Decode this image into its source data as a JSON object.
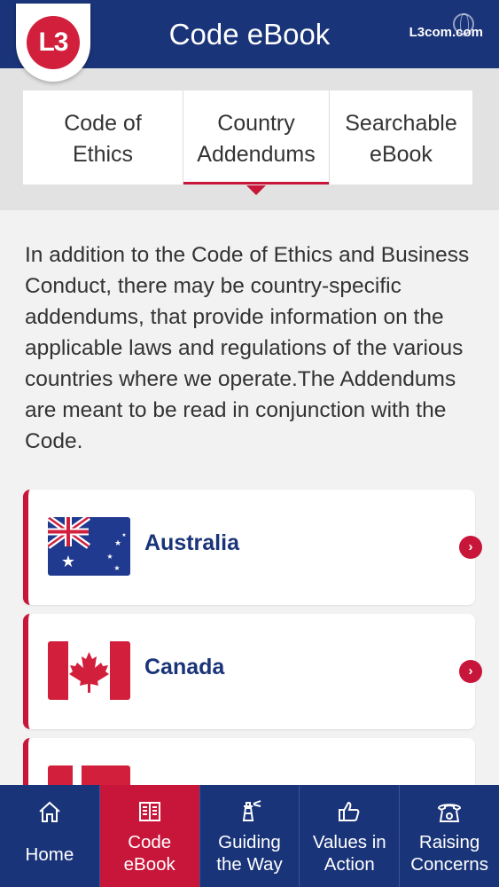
{
  "header": {
    "title": "Code eBook",
    "logo_text": "L3",
    "link": "L3com.com"
  },
  "tabs": [
    {
      "line1": "Code of",
      "line2": "Ethics",
      "active": false
    },
    {
      "line1": "Country",
      "line2": "Addendums",
      "active": true
    },
    {
      "line1": "Searchable",
      "line2": "eBook",
      "active": false
    }
  ],
  "intro_text": "In addition to the Code of Ethics and Business Conduct, there may be country-specific addendums, that provide information on the applicable laws and regulations of the various countries where we operate.The Addendums are meant to be read in conjunction with the Code.",
  "countries": [
    {
      "name": "Australia",
      "flag": "australia-flag"
    },
    {
      "name": "Canada",
      "flag": "canada-flag"
    },
    {
      "name": "",
      "flag": "denmark-flag"
    }
  ],
  "bottom_nav": [
    {
      "line1": "Home",
      "line2": "",
      "icon": "home-icon",
      "active": false
    },
    {
      "line1": "Code",
      "line2": "eBook",
      "icon": "book-icon",
      "active": true
    },
    {
      "line1": "Guiding",
      "line2": "the Way",
      "icon": "lighthouse-icon",
      "active": false
    },
    {
      "line1": "Values in",
      "line2": "Action",
      "icon": "thumbs-up-icon",
      "active": false
    },
    {
      "line1": "Raising",
      "line2": "Concerns",
      "icon": "phone-icon",
      "active": false
    }
  ],
  "colors": {
    "brand_navy": "#1a3479",
    "brand_red": "#c8163a",
    "background": "#f2f2f2"
  }
}
